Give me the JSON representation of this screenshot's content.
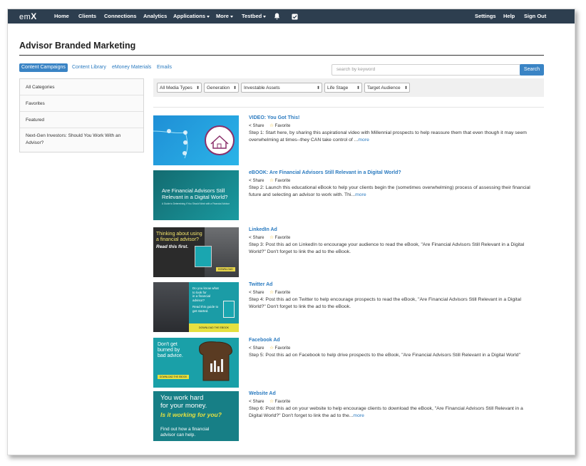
{
  "nav": {
    "logo": {
      "prefix": "em",
      "suffix": "X"
    },
    "left_items": [
      "Home",
      "Clients",
      "Connections",
      "Analytics",
      "Applications",
      "More",
      "Testbed"
    ],
    "right_items": [
      "Settings",
      "Help",
      "Sign Out"
    ]
  },
  "page": {
    "title": "Advisor Branded Marketing"
  },
  "tabs": [
    "Content Campaigns",
    "Content Library",
    "eMoney Materials",
    "Emails"
  ],
  "search": {
    "placeholder": "search by keyword",
    "button": "Search"
  },
  "sidebar": {
    "items": [
      "All Categories",
      "Favorites",
      "Featured",
      "Next-Gen Investors: Should You Work With an Advisor?"
    ]
  },
  "filters": [
    "All Media Types",
    "Generation",
    "Investable Assets",
    "Life Stage",
    "Target Audience"
  ],
  "actions": {
    "share": "Share",
    "favorite": "Favorite"
  },
  "items": [
    {
      "title": "VIDEO: You Got This!",
      "desc": "Step 1: Start here, by sharing this aspirational video with Millennial prospects to help reassure them that even though it may seem overwhelming at times--they CAN take control of ...",
      "more": "more"
    },
    {
      "title": "eBOOK: Are Financial Advisors Still Relevant in a Digital World?",
      "desc": "Step 2: Launch this educational eBook to help your clients begin the (sometimes overwhelming) process of assessing their financial future and selecting an advisor to work with. Thi...",
      "more": "more",
      "thumb": {
        "line1": "Are Financial Advisors Still",
        "line2": "Relevant in a Digital World?",
        "sub": "A Guide to Determining If You Should Work with a Financial Advisor"
      }
    },
    {
      "title": "LinkedIn Ad",
      "desc": "Step 3: Post this ad on LinkedIn to encourage your audience to read the eBook, \"Are Financial Advisors Still Relevant in a Digital World?\" Don't forget to link the ad to the eBook.",
      "more": "",
      "thumb": {
        "line1": "Thinking about using",
        "line2": "a financial advisor?",
        "line3": "Read this first.",
        "cta": "DOWNLOAD"
      }
    },
    {
      "title": "Twitter Ad",
      "desc": "Step 4: Post this ad on Twitter to help encourage prospects to read the eBook, \"Are Financial Advisors Still Relevant in a Digital World?\" Don't forget to link the ad to the eBook.",
      "more": "",
      "thumb": {
        "line1": "Do you know what",
        "line2": "to look for",
        "line3": "in a financial",
        "line4": "advisor?",
        "line5": "Read this guide to",
        "line6": "get started.",
        "cta": "DOWNLOAD THE EBOOK"
      }
    },
    {
      "title": "Facebook Ad",
      "desc": "Step 5: Post this ad on Facebook to help drive prospects to the eBook, \"Are Financial Advisors Still Relevant in a Digital World\"",
      "more": "",
      "thumb": {
        "line1": "Don't get",
        "line2": "burned by",
        "line3": "bad advice.",
        "cta": "DOWNLOAD THE EBOOK"
      }
    },
    {
      "title": "Website Ad",
      "desc": "Step 6: Post this ad on your website to help encourage clients to download the eBook, \"Are Financial Advisors Still Relevant in a Digital World?\" Don't forget to link the ad to the...",
      "more": "more",
      "thumb": {
        "line1": "You work hard",
        "line2": "for your money.",
        "line3": "Is it working for you?",
        "line4": "Find out how a financial",
        "line5": "advisor can help."
      }
    }
  ],
  "colors": {
    "navbar": "#2d3e4f",
    "accent": "#3a84c5",
    "link": "#2b7bc0"
  }
}
